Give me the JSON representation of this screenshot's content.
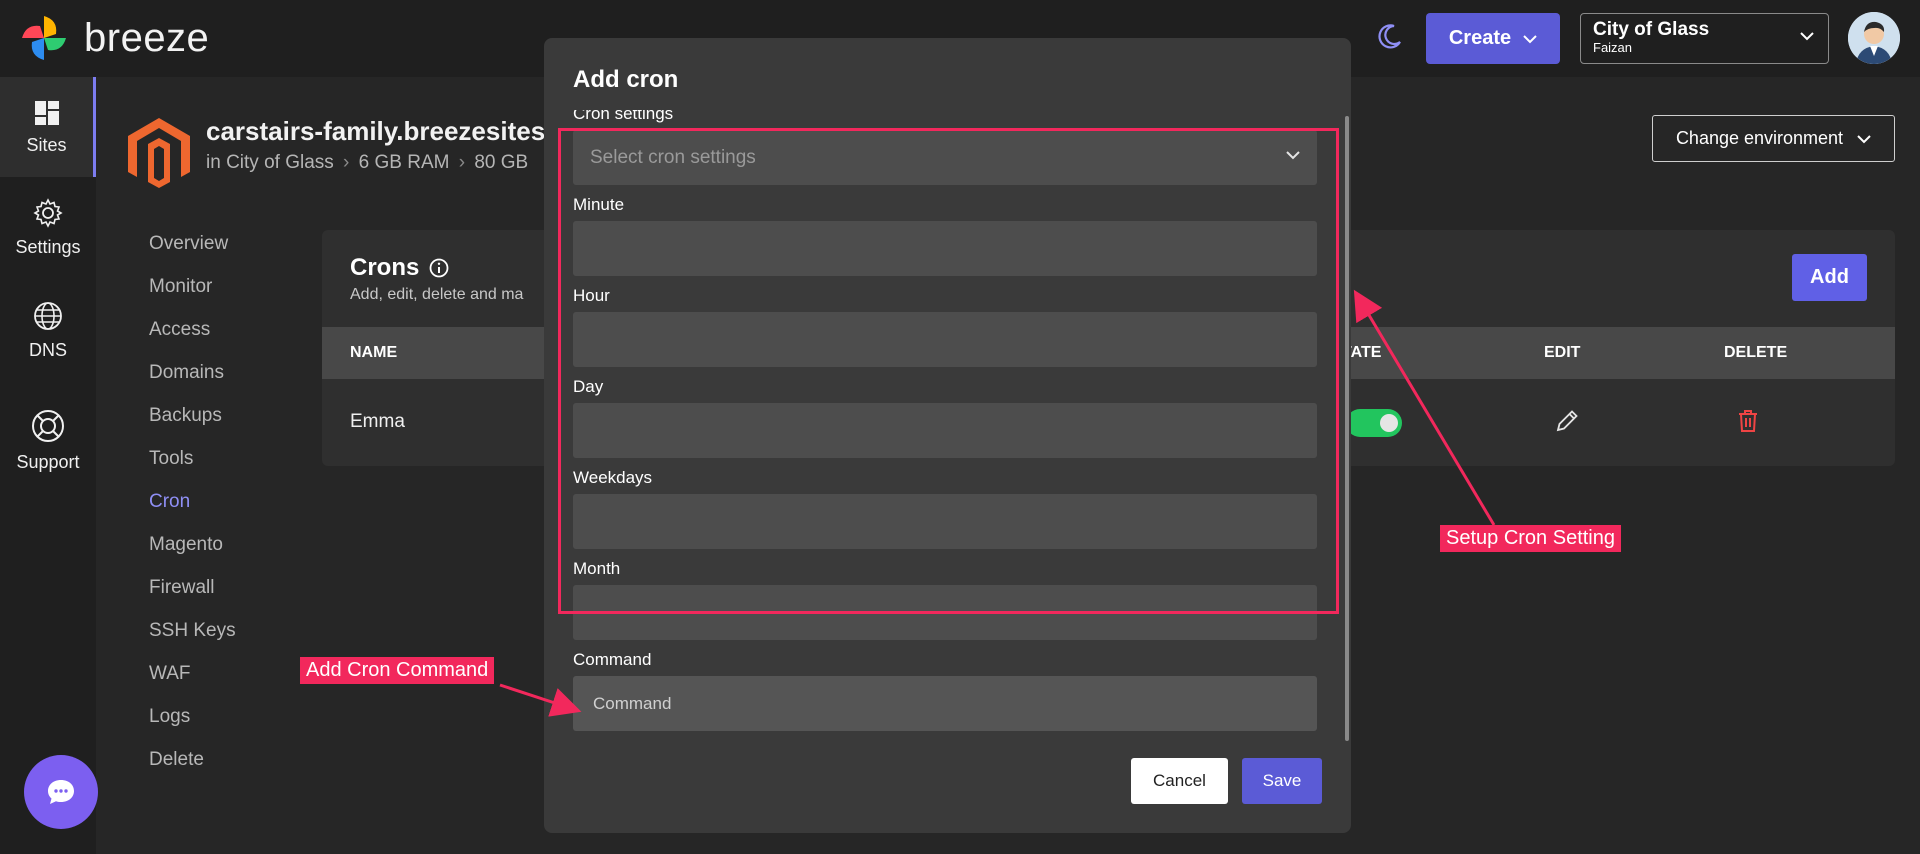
{
  "app": {
    "brand": "breeze"
  },
  "topbar": {
    "create_label": "Create",
    "org_name": "City of Glass",
    "org_user": "Faizan"
  },
  "rail": {
    "items": [
      {
        "label": "Sites",
        "icon": "dashboard-icon",
        "active": true
      },
      {
        "label": "Settings",
        "icon": "gear-icon"
      },
      {
        "label": "DNS",
        "icon": "globe-icon"
      },
      {
        "label": "Support",
        "icon": "lifebuoy-icon"
      }
    ]
  },
  "site": {
    "title": "carstairs-family.breezesites.i",
    "location": "in City of Glass",
    "ram": "6 GB RAM",
    "disk": "80 GB",
    "env_button": "Change environment"
  },
  "sidenav": {
    "items": [
      "Overview",
      "Monitor",
      "Access",
      "Domains",
      "Backups",
      "Tools",
      "Cron",
      "Magento",
      "Firewall",
      "SSH Keys",
      "WAF",
      "Logs",
      "Delete"
    ],
    "active": "Cron"
  },
  "crons": {
    "title": "Crons",
    "subtitle": "Add, edit, delete and ma",
    "add_label": "Add",
    "headers": {
      "name": "NAME",
      "state": "TATE",
      "edit": "EDIT",
      "delete": "DELETE"
    },
    "rows": [
      {
        "name": "Emma",
        "enabled": true
      }
    ]
  },
  "modal": {
    "title": "Add cron",
    "cron_settings_label": "Cron settings",
    "cron_settings_placeholder": "Select cron settings",
    "minute_label": "Minute",
    "hour_label": "Hour",
    "day_label": "Day",
    "weekdays_label": "Weekdays",
    "month_label": "Month",
    "command_label": "Command",
    "command_placeholder": "Command",
    "cancel_label": "Cancel",
    "save_label": "Save"
  },
  "annotations": {
    "setup": "Setup Cron Setting",
    "command": "Add Cron Command"
  },
  "colors": {
    "accent": "#5b5bd6",
    "annotation": "#f2285c",
    "toggle_on": "#22c55e",
    "delete": "#ef4444"
  }
}
